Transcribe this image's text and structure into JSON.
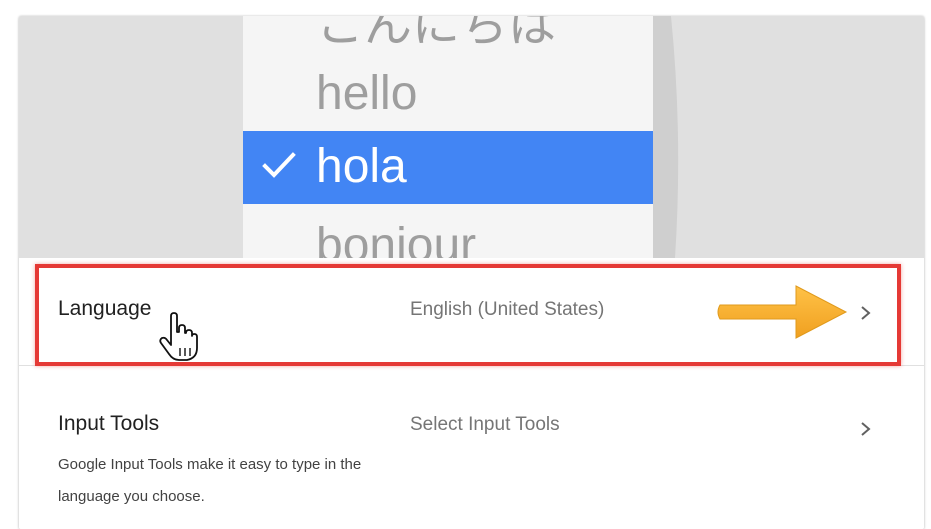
{
  "banner": {
    "words": {
      "japanese": "こんにちは",
      "hello": "hello",
      "selected": "hola",
      "bonjour": "bonjour"
    }
  },
  "settings": {
    "language": {
      "title": "Language",
      "value": "English (United States)"
    },
    "input_tools": {
      "title": "Input Tools",
      "value": "Select Input Tools",
      "description": "Google Input Tools make it easy to type in the language you choose."
    }
  },
  "colors": {
    "selection": "#4285f4",
    "highlight_border": "#e53935",
    "arrow": "#f5a623"
  }
}
